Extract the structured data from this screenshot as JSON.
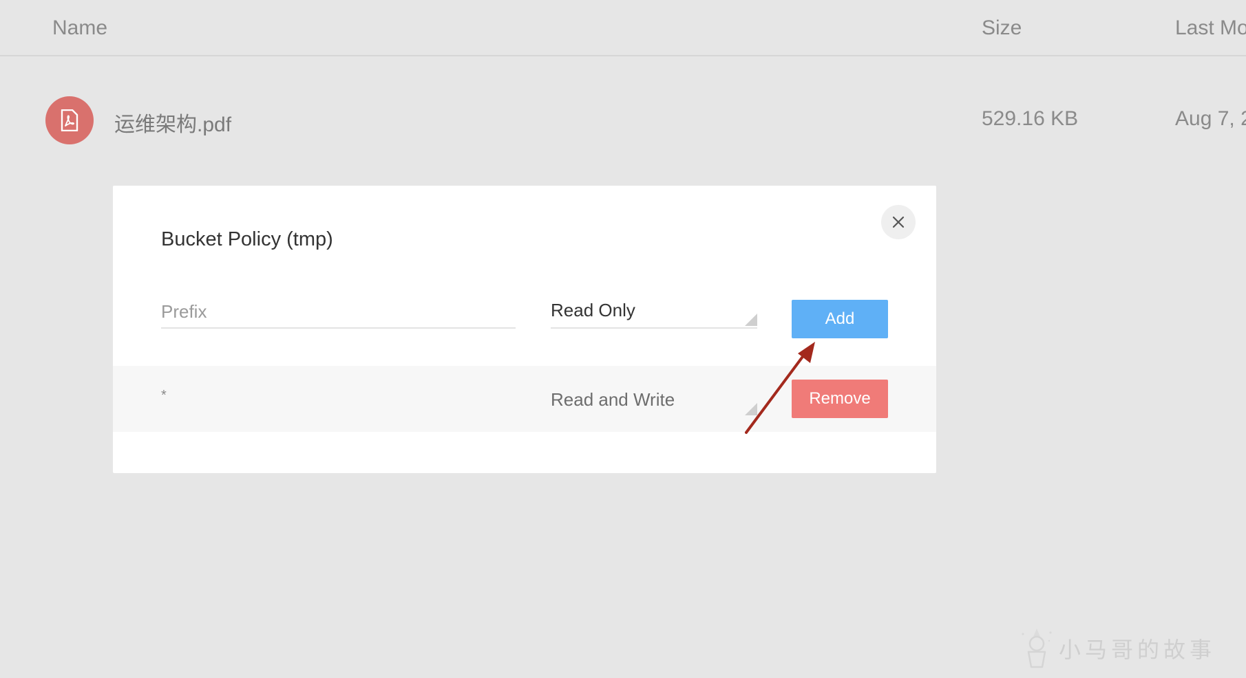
{
  "list": {
    "headers": {
      "name": "Name",
      "size": "Size",
      "modified": "Last Mo"
    },
    "files": [
      {
        "name": "运维架构.pdf",
        "size": "529.16 KB",
        "modified": "Aug 7, 2",
        "icon": "pdf-icon"
      }
    ]
  },
  "modal": {
    "title": "Bucket Policy (tmp)",
    "prefix_placeholder": "Prefix",
    "new_policy_value": "Read Only",
    "add_label": "Add",
    "policies": [
      {
        "prefix": "*",
        "permission": "Read and Write",
        "remove_label": "Remove"
      }
    ]
  },
  "watermark": {
    "text": "小马哥的故事"
  },
  "colors": {
    "page_bg": "#e6e6e6",
    "file_icon_bg": "#d9716d",
    "add_button": "#5fb0f6",
    "remove_button": "#f07b78",
    "annotation_arrow": "#a3291d"
  }
}
